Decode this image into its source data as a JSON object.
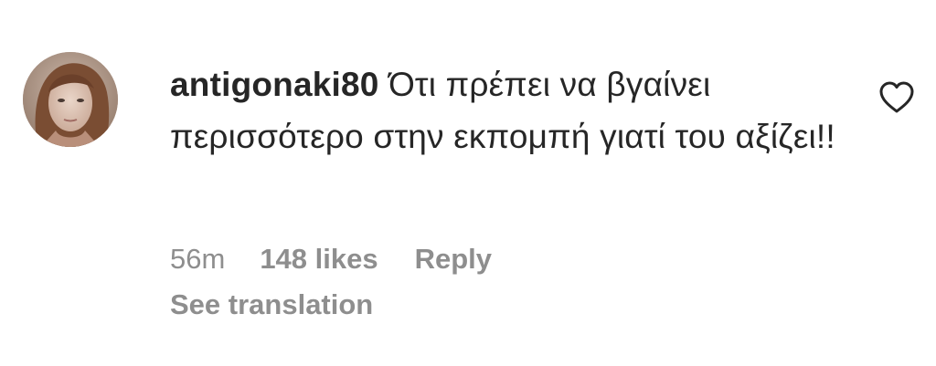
{
  "comment": {
    "username": "antigonaki80",
    "text": "Ότι πρέπει να βγαίνει περισσότερο στην εκπομπή γιατί του αξίζει!!",
    "time": "56m",
    "likes": "148 likes",
    "reply_label": "Reply",
    "translation_label": "See translation",
    "like_icon": "heart-outline-icon"
  },
  "colors": {
    "text": "#262626",
    "secondary": "#8e8e8e",
    "background": "#ffffff"
  }
}
